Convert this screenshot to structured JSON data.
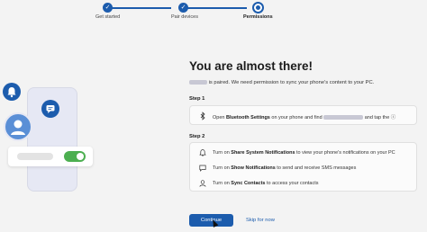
{
  "stepper": {
    "steps": [
      {
        "label": "Get started",
        "state": "done"
      },
      {
        "label": "Pair devices",
        "state": "done"
      },
      {
        "label": "Permissions",
        "state": "current"
      }
    ]
  },
  "main": {
    "title": "You are almost there!",
    "subtitle_suffix": "is paired. We need permission to sync your phone's content to your PC.",
    "step1": {
      "heading": "Step 1",
      "icon": "bluetooth-icon",
      "text_prefix": "Open ",
      "text_bold": "Bluetooth Settings",
      "text_middle": " on your phone and find ",
      "text_suffix": " and tap the ⓘ"
    },
    "step2": {
      "heading": "Step 2",
      "items": [
        {
          "icon": "bell-icon",
          "prefix": "Turn on ",
          "bold": "Share System Notifications",
          "suffix": " to view your phone's notifications on your PC"
        },
        {
          "icon": "chat-icon",
          "prefix": "Turn on ",
          "bold": "Show Notifications",
          "suffix": " to send and receive SMS messages"
        },
        {
          "icon": "person-icon",
          "prefix": "Turn on ",
          "bold": "Sync Contacts",
          "suffix": " to access your contacts"
        }
      ]
    },
    "continue_label": "Continue",
    "skip_label": "Skip for now"
  },
  "colors": {
    "accent": "#1c5cad",
    "toggle_on": "#4caf50",
    "background": "#f3f3f3"
  }
}
